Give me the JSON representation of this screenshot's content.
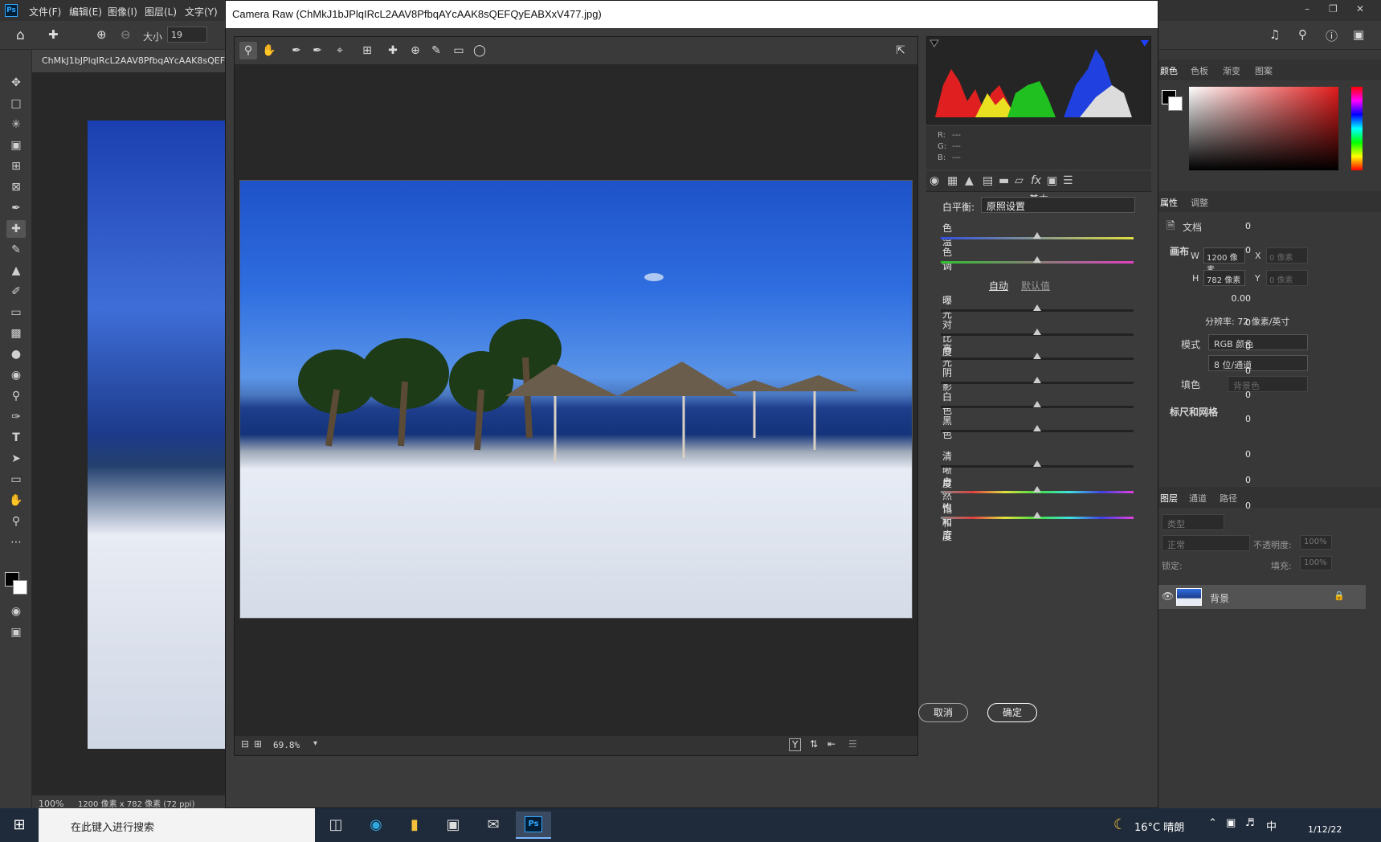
{
  "ps": {
    "logo": "Ps",
    "menus": [
      "文件(F)",
      "编辑(E)",
      "图像(I)",
      "图层(L)",
      "文字(Y)"
    ],
    "options": {
      "size_label": "大小",
      "size_value": "19"
    },
    "doc_tab": "ChMkJ1bJPlqIRcL2AAV8PfbqAYcAAK8sQEF",
    "status": {
      "zoom": "100%",
      "dims": "1200 像素 x 782 像素 (72 ppi)"
    }
  },
  "camera_raw": {
    "title": "Camera Raw (ChMkJ1bJPlqIRcL2AAV8PfbqAYcAAK8sQEFQyEABXxV477.jpg)",
    "zoom": "69.8%",
    "rgb": {
      "r": "R:",
      "g": "G:",
      "b": "B:",
      "dash": "---"
    },
    "panel_title": "基本",
    "white_balance": {
      "label": "白平衡:",
      "value": "原照设置"
    },
    "auto_label": "自动",
    "default_label": "默认值",
    "sliders": [
      {
        "label": "色温",
        "value": "0",
        "pos": 0.5
      },
      {
        "label": "色调",
        "value": "0",
        "pos": 0.5
      },
      {
        "label": "曝光",
        "value": "0.00",
        "pos": 0.5
      },
      {
        "label": "对比度",
        "value": "0",
        "pos": 0.5
      },
      {
        "label": "高光",
        "value": "0",
        "pos": 0.5
      },
      {
        "label": "阴影",
        "value": "0",
        "pos": 0.5
      },
      {
        "label": "白色",
        "value": "0",
        "pos": 0.5
      },
      {
        "label": "黑色",
        "value": "0",
        "pos": 0.5
      },
      {
        "label": "清晰度",
        "value": "0",
        "pos": 0.5
      },
      {
        "label": "自然饱和度",
        "value": "0",
        "pos": 0.5
      },
      {
        "label": "饱和度",
        "value": "0",
        "pos": 0.5
      }
    ],
    "cancel": "取消",
    "ok": "确定"
  },
  "panels": {
    "color_tabs": [
      "颜色",
      "色板",
      "渐变",
      "图案"
    ],
    "props_tabs": [
      "属性",
      "调整"
    ],
    "doc_label": "文档",
    "canvas_section": "画布",
    "w_label": "W",
    "w_value": "1200 像素",
    "h_label": "H",
    "h_value": "782 像素",
    "x_label": "X",
    "x_value": "0 像素",
    "y_label": "Y",
    "y_value": "0 像素",
    "resolution": "分辨率: 72 像素/英寸",
    "mode_label": "模式",
    "mode_value": "RGB 颜色",
    "depth_value": "8 位/通道",
    "fill_label": "填色",
    "fill_value": "背景色",
    "rulers_section": "标尺和网格",
    "layers_tabs": [
      "图层",
      "通道",
      "路径"
    ],
    "layer_kind": "类型",
    "blend": "正常",
    "opacity_label": "不透明度:",
    "opacity_value": "100%",
    "lock_label": "锁定:",
    "fill_pct_label": "填充:",
    "fill_pct_value": "100%",
    "layer_name": "背景"
  },
  "taskbar": {
    "search_placeholder": "在此键入进行搜索",
    "weather": "16°C 晴朗",
    "ime": "中",
    "date": "1/12/22"
  }
}
